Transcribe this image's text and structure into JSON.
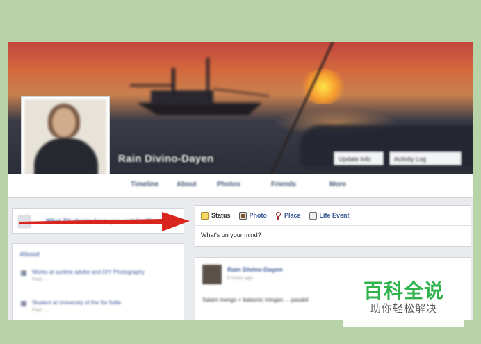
{
  "profile": {
    "name": "Rain Divino-Dayen",
    "buttons": [
      "Update Info",
      "Activity Log"
    ],
    "nav_tabs": [
      "Timeline",
      "About",
      "Photos",
      "Friends",
      "More"
    ]
  },
  "left_column": {
    "friends_prompt": "What TV shows have you watched?",
    "about_heading": "About",
    "about_items": [
      {
        "title": "Works at sunline adobe and DIY Photography",
        "sub": "Past: ..."
      },
      {
        "title": "Student at University of the Sa Salle",
        "sub": "Past: ..."
      }
    ]
  },
  "composer": {
    "tabs": [
      {
        "label": "Status",
        "icon": "status-icon"
      },
      {
        "label": "Photo",
        "icon": "photo-icon"
      },
      {
        "label": "Place",
        "icon": "place-icon"
      },
      {
        "label": "Life Event",
        "icon": "life-event-icon"
      }
    ],
    "placeholder": "What's on your mind?"
  },
  "feed": {
    "author": "Rain Divino-Dayen",
    "meta": "8 hours ago",
    "text": "Salam mengo + balasnic mingan ... pasakit"
  },
  "watermark": {
    "title": "百科全说",
    "subtitle": "助你轻松解决"
  },
  "colors": {
    "page_bg": "#b9d3a9",
    "arrow": "#d9251d",
    "watermark_green": "#2fb34a"
  }
}
